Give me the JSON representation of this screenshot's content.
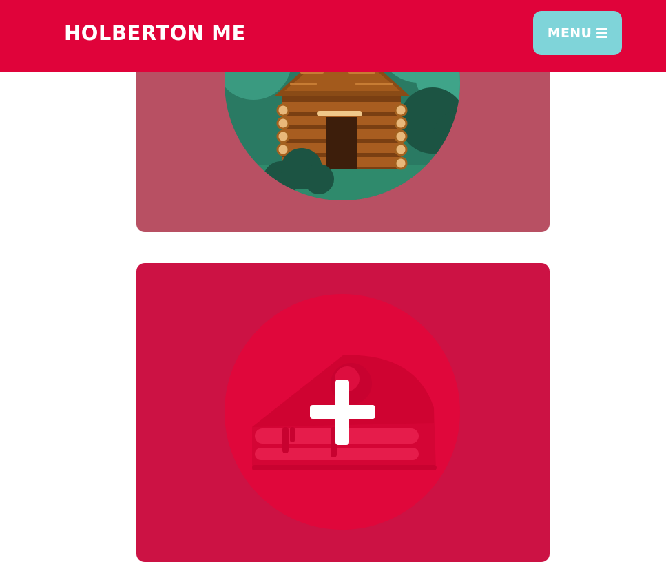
{
  "header": {
    "brand": "HOLBERTON ME",
    "menu_label": "MENU",
    "menu_icon": "hamburger-icon"
  },
  "portfolio": {
    "items": [
      {
        "image": "log-cabin-illustration",
        "overlay_icon": null
      },
      {
        "image": "pie-slice-illustration",
        "overlay_icon": "plus-icon"
      }
    ]
  },
  "colors": {
    "header_bg": "#e0033a",
    "menu_button_bg": "#7fd4d9",
    "card_cabin_bg": "#b85063",
    "card_pie_bg": "#cc1244",
    "pie_circle": "#e0073b",
    "forest_circle": "#2a7a63",
    "text": "#ffffff"
  }
}
